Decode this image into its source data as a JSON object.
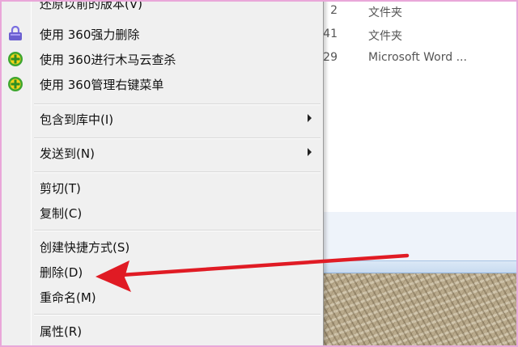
{
  "explorer": {
    "rows": [
      {
        "num": "2",
        "type": "文件夹"
      },
      {
        "num": "41",
        "type": "文件夹"
      },
      {
        "num": "29",
        "type": "Microsoft Word ..."
      }
    ]
  },
  "menu": {
    "items": [
      {
        "label": "还原以前的版本(V)"
      },
      {
        "label": "使用 360强力删除",
        "icon": "lock-shield-icon"
      },
      {
        "label": "使用 360进行木马云查杀",
        "icon": "360-plus-icon"
      },
      {
        "label": "使用 360管理右键菜单",
        "icon": "360-plus-icon"
      },
      {
        "label": "包含到库中(I)",
        "submenu": true
      },
      {
        "label": "发送到(N)",
        "submenu": true
      },
      {
        "label": "剪切(T)"
      },
      {
        "label": "复制(C)"
      },
      {
        "label": "创建快捷方式(S)"
      },
      {
        "label": "删除(D)"
      },
      {
        "label": "重命名(M)"
      },
      {
        "label": "属性(R)"
      }
    ]
  },
  "annotation": {
    "arrow_color": "#e01b24",
    "points_to": "删除(D)"
  },
  "colors": {
    "frame": "#e9a7d9",
    "menu_bg": "#f0f0f0"
  }
}
